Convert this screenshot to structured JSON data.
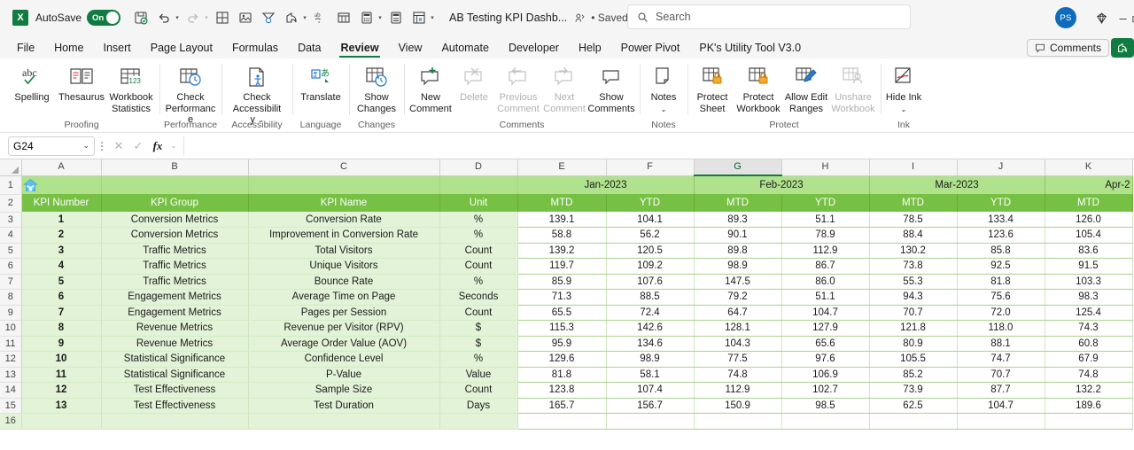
{
  "titlebar": {
    "app_logo": "excel-logo",
    "autosave_label": "AutoSave",
    "autosave_state": "On",
    "document_title": "AB Testing KPI Dashb...",
    "saved_state": "• Saved",
    "quick_access": [
      {
        "name": "save-icon",
        "label": "Save"
      },
      {
        "name": "undo-icon",
        "label": "Undo"
      },
      {
        "name": "redo-icon",
        "label": "Redo"
      },
      {
        "name": "borders-icon",
        "label": "Borders"
      },
      {
        "name": "insert-picture-icon",
        "label": "Picture"
      },
      {
        "name": "filter-icon",
        "label": "Filter"
      },
      {
        "name": "share-arrow-icon",
        "label": "Share"
      },
      {
        "name": "spelling-icon",
        "label": "Spelling"
      },
      {
        "name": "table-icon",
        "label": "Table"
      },
      {
        "name": "calculator-icon",
        "label": "Calculator"
      },
      {
        "name": "calculate-now-icon",
        "label": "Calculate Now"
      },
      {
        "name": "sheet-view-icon",
        "label": "Sheet View"
      },
      {
        "name": "customize-qat-icon",
        "label": "Customize"
      }
    ],
    "search_placeholder": "Search",
    "avatar_initials": "PS",
    "diamond_icon": "diamond-icon",
    "window_minimize": "minimize-icon",
    "window_restore": "restore-icon"
  },
  "tabs": [
    {
      "label": "File",
      "active": false
    },
    {
      "label": "Home",
      "active": false
    },
    {
      "label": "Insert",
      "active": false
    },
    {
      "label": "Page Layout",
      "active": false
    },
    {
      "label": "Formulas",
      "active": false
    },
    {
      "label": "Data",
      "active": false
    },
    {
      "label": "Review",
      "active": true
    },
    {
      "label": "View",
      "active": false
    },
    {
      "label": "Automate",
      "active": false
    },
    {
      "label": "Developer",
      "active": false
    },
    {
      "label": "Help",
      "active": false
    },
    {
      "label": "Power Pivot",
      "active": false
    },
    {
      "label": "PK's Utility Tool V3.0",
      "active": false
    }
  ],
  "comments_button": "Comments",
  "ribbon_groups": [
    {
      "name": "Proofing",
      "buttons": [
        {
          "label": "Spelling",
          "icon": "spell-check-icon",
          "disabled": false,
          "dropdown": false
        },
        {
          "label": "Thesaurus",
          "icon": "thesaurus-book-icon",
          "disabled": false,
          "dropdown": false
        },
        {
          "label": "Workbook Statistics",
          "icon": "workbook-statistics-icon",
          "disabled": false,
          "dropdown": false
        }
      ]
    },
    {
      "name": "Performance",
      "buttons": [
        {
          "label": "Check Performance",
          "icon": "check-performance-icon",
          "disabled": false,
          "dropdown": false
        }
      ]
    },
    {
      "name": "Accessibility",
      "buttons": [
        {
          "label": "Check Accessibility",
          "icon": "check-accessibility-icon",
          "disabled": false,
          "dropdown": true
        }
      ]
    },
    {
      "name": "Language",
      "buttons": [
        {
          "label": "Translate",
          "icon": "translate-icon",
          "disabled": false,
          "dropdown": false
        }
      ]
    },
    {
      "name": "Changes",
      "buttons": [
        {
          "label": "Show Changes",
          "icon": "show-changes-icon",
          "disabled": false,
          "dropdown": false
        }
      ]
    },
    {
      "name": "Comments",
      "buttons": [
        {
          "label": "New Comment",
          "icon": "new-comment-icon",
          "disabled": false,
          "dropdown": false
        },
        {
          "label": "Delete",
          "icon": "delete-comment-icon",
          "disabled": true,
          "dropdown": false
        },
        {
          "label": "Previous Comment",
          "icon": "previous-comment-icon",
          "disabled": true,
          "dropdown": false
        },
        {
          "label": "Next Comment",
          "icon": "next-comment-icon",
          "disabled": true,
          "dropdown": false
        },
        {
          "label": "Show Comments",
          "icon": "show-comments-icon",
          "disabled": false,
          "dropdown": false
        }
      ]
    },
    {
      "name": "Notes",
      "buttons": [
        {
          "label": "Notes",
          "icon": "notes-icon",
          "disabled": false,
          "dropdown": true
        }
      ]
    },
    {
      "name": "Protect",
      "buttons": [
        {
          "label": "Protect Sheet",
          "icon": "protect-sheet-icon",
          "disabled": false,
          "dropdown": false
        },
        {
          "label": "Protect Workbook",
          "icon": "protect-workbook-icon",
          "disabled": false,
          "dropdown": false
        },
        {
          "label": "Allow Edit Ranges",
          "icon": "allow-edit-ranges-icon",
          "disabled": false,
          "dropdown": false
        },
        {
          "label": "Unshare Workbook",
          "icon": "unshare-workbook-icon",
          "disabled": true,
          "dropdown": false
        }
      ]
    },
    {
      "name": "Ink",
      "buttons": [
        {
          "label": "Hide Ink",
          "icon": "hide-ink-icon",
          "disabled": false,
          "dropdown": true
        }
      ]
    }
  ],
  "formula_bar": {
    "name_box_value": "G24",
    "cancel_icon": "cancel-icon",
    "enter_icon": "enter-icon",
    "function_icon": "fx-icon",
    "formula_value": ""
  },
  "grid": {
    "selected_cell": "G24",
    "selected_column": "G",
    "column_headers": [
      "A",
      "B",
      "C",
      "D",
      "E",
      "F",
      "G",
      "H",
      "I",
      "J",
      "K"
    ],
    "row_numbers": [
      "1",
      "2",
      "3",
      "4",
      "5",
      "6",
      "7",
      "8",
      "9",
      "10",
      "11",
      "12",
      "13",
      "14",
      "15",
      "16"
    ],
    "home_icon": "home-icon",
    "month_bands": [
      {
        "label": "Jan-2023",
        "span": 2
      },
      {
        "label": "Feb-2023",
        "span": 2
      },
      {
        "label": "Mar-2023",
        "span": 2
      },
      {
        "label": "Apr-2",
        "span": 1
      }
    ],
    "headers": [
      "KPI Number",
      "KPI Group",
      "KPI Name",
      "Unit",
      "MTD",
      "YTD",
      "MTD",
      "YTD",
      "MTD",
      "YTD",
      "MTD"
    ],
    "rows": [
      {
        "row": "3",
        "cells": [
          "1",
          "Conversion Metrics",
          "Conversion Rate",
          "%",
          "139.1",
          "104.1",
          "89.3",
          "51.1",
          "78.5",
          "133.4",
          "126.0"
        ]
      },
      {
        "row": "4",
        "cells": [
          "2",
          "Conversion Metrics",
          "Improvement in Conversion Rate",
          "%",
          "58.8",
          "56.2",
          "90.1",
          "78.9",
          "88.4",
          "123.6",
          "105.4"
        ]
      },
      {
        "row": "5",
        "cells": [
          "3",
          "Traffic Metrics",
          "Total Visitors",
          "Count",
          "139.2",
          "120.5",
          "89.8",
          "112.9",
          "130.2",
          "85.8",
          "83.6"
        ]
      },
      {
        "row": "6",
        "cells": [
          "4",
          "Traffic Metrics",
          "Unique Visitors",
          "Count",
          "119.7",
          "109.2",
          "98.9",
          "86.7",
          "73.8",
          "92.5",
          "91.5"
        ]
      },
      {
        "row": "7",
        "cells": [
          "5",
          "Traffic Metrics",
          "Bounce Rate",
          "%",
          "85.9",
          "107.6",
          "147.5",
          "86.0",
          "55.3",
          "81.8",
          "103.3"
        ]
      },
      {
        "row": "8",
        "cells": [
          "6",
          "Engagement Metrics",
          "Average Time on Page",
          "Seconds",
          "71.3",
          "88.5",
          "79.2",
          "51.1",
          "94.3",
          "75.6",
          "98.3"
        ]
      },
      {
        "row": "9",
        "cells": [
          "7",
          "Engagement Metrics",
          "Pages per Session",
          "Count",
          "65.5",
          "72.4",
          "64.7",
          "104.7",
          "70.7",
          "72.0",
          "125.4"
        ]
      },
      {
        "row": "10",
        "cells": [
          "8",
          "Revenue Metrics",
          "Revenue per Visitor (RPV)",
          "$",
          "115.3",
          "142.6",
          "128.1",
          "127.9",
          "121.8",
          "118.0",
          "74.3"
        ]
      },
      {
        "row": "11",
        "cells": [
          "9",
          "Revenue Metrics",
          "Average Order Value (AOV)",
          "$",
          "95.9",
          "134.6",
          "104.3",
          "65.6",
          "80.9",
          "88.1",
          "60.8"
        ]
      },
      {
        "row": "12",
        "cells": [
          "10",
          "Statistical Significance",
          "Confidence Level",
          "%",
          "129.6",
          "98.9",
          "77.5",
          "97.6",
          "105.5",
          "74.7",
          "67.9"
        ]
      },
      {
        "row": "13",
        "cells": [
          "11",
          "Statistical Significance",
          "P-Value",
          "Value",
          "81.8",
          "58.1",
          "74.8",
          "106.9",
          "85.2",
          "70.7",
          "74.8"
        ]
      },
      {
        "row": "14",
        "cells": [
          "12",
          "Test Effectiveness",
          "Sample Size",
          "Count",
          "123.8",
          "107.4",
          "112.9",
          "102.7",
          "73.9",
          "87.7",
          "132.2"
        ]
      },
      {
        "row": "15",
        "cells": [
          "13",
          "Test Effectiveness",
          "Test Duration",
          "Days",
          "165.7",
          "156.7",
          "150.9",
          "98.5",
          "62.5",
          "104.7",
          "189.6"
        ]
      }
    ]
  },
  "colors": {
    "excel_green": "#107c41",
    "header_band": "#b0e18c",
    "header_row": "#76c043",
    "data_fill": "#e2f3d7",
    "accent_blue": "#0f6cbd"
  }
}
